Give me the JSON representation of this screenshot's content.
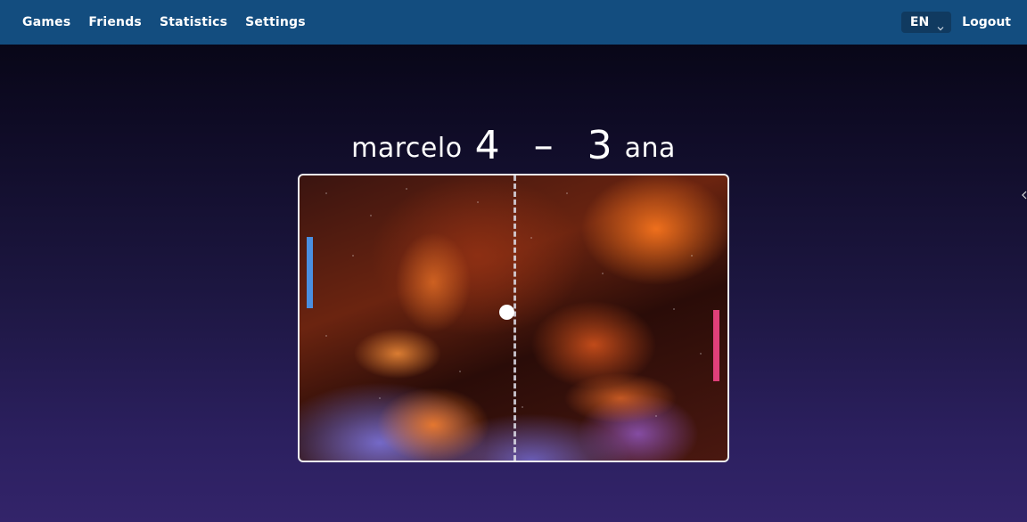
{
  "nav": {
    "links": [
      "Games",
      "Friends",
      "Statistics",
      "Settings"
    ],
    "language": "EN",
    "logout_label": "Logout"
  },
  "match": {
    "left_player": "marcelo",
    "left_score": "4",
    "separator": "–",
    "right_score": "3",
    "right_player": "ana"
  },
  "colors": {
    "navbar": "#134d7f",
    "left_paddle": "#4a8fe0",
    "right_paddle": "#e0407a",
    "ball": "#ffffff"
  },
  "icons": {
    "language_dropdown": "chevron-down-icon"
  }
}
